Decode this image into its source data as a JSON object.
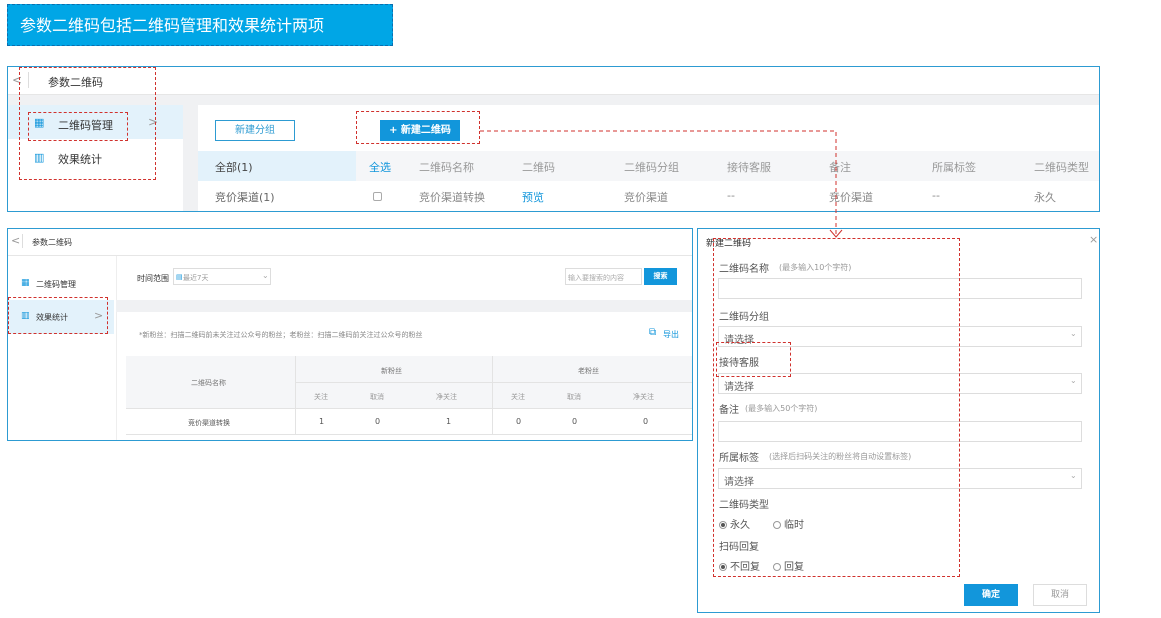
{
  "banner": {
    "title": "参数二维码包括二维码管理和效果统计两项"
  },
  "panel1": {
    "back": "<",
    "title": "参数二维码",
    "sidebar": [
      {
        "label": "二维码管理",
        "icon": "grid-icon",
        "arrow": ">"
      },
      {
        "label": "效果统计",
        "icon": "bar-chart-icon"
      }
    ],
    "new_group_button": "新建分组",
    "new_qrcode_button": "+ 新建二维码",
    "groups": [
      "全部(1)",
      "竞价渠道(1)"
    ],
    "columns": [
      "全选",
      "二维码名称",
      "二维码",
      "二维码分组",
      "接待客服",
      "备注",
      "所属标签",
      "二维码类型"
    ],
    "row": [
      "竞价渠道转换",
      "预览",
      "竞价渠道",
      "--",
      "竞价渠道",
      "--",
      "永久"
    ]
  },
  "panel2": {
    "back": "<",
    "title": "参数二维码",
    "sidebar": [
      {
        "label": "二维码管理",
        "icon": "grid-icon"
      },
      {
        "label": "效果统计",
        "icon": "bar-chart-icon",
        "arrow": ">"
      }
    ],
    "time_label": "时间范围",
    "time_value": "最近7天",
    "search_placeholder": "输入要搜索的内容",
    "search_button": "搜索",
    "note": "*新粉丝：扫描二维码前未关注过公众号的粉丝；老粉丝：扫描二维码前关注过公众号的粉丝",
    "export": "导出",
    "table": {
      "name_header": "二维码名称",
      "new_fans": "新粉丝",
      "old_fans": "老粉丝",
      "sub_headers": [
        "关注",
        "取消",
        "净关注",
        "关注",
        "取消",
        "净关注"
      ],
      "row_name": "竞价渠道转换",
      "row_values": [
        "1",
        "0",
        "1",
        "0",
        "0",
        "0"
      ]
    }
  },
  "panel3": {
    "title": "新建二维码",
    "close": "×",
    "name_label": "二维码名称",
    "name_hint": "(最多输入10个字符)",
    "group_label": "二维码分组",
    "group_value": "请选择",
    "service_label": "接待客服",
    "service_value": "请选择",
    "remark_label": "备注",
    "remark_hint": "(最多输入50个字符)",
    "tag_label": "所属标签",
    "tag_hint": "(选择后扫码关注的粉丝将自动设置标签)",
    "tag_value": "请选择",
    "type_label": "二维码类型",
    "type_options": [
      "永久",
      "临时"
    ],
    "reply_label": "扫码回复",
    "reply_options": [
      "不回复",
      "回复"
    ],
    "confirm": "确定",
    "cancel": "取消"
  },
  "colors": {
    "accent": "#1296db",
    "annotation": "#d0312d",
    "banner": "#00a6e6"
  }
}
